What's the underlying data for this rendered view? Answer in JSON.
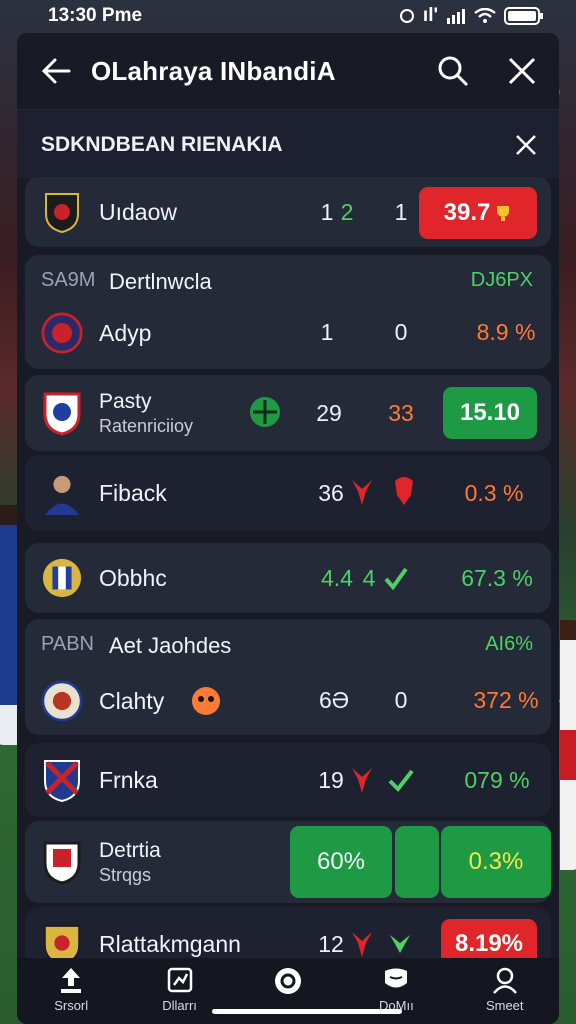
{
  "status_bar": {
    "time": "13:30",
    "carrier": "Pme",
    "signal_text": "ıl'"
  },
  "header": {
    "title": "OLahraya INbandiA",
    "section_title": "SDKNDBEAN RIENAKIA"
  },
  "rows": [
    {
      "team": "Uıdaow",
      "score_a": "1",
      "score_b": "2",
      "score_c": "1",
      "pct": "39.7",
      "pct_style": "red-pill"
    },
    {
      "section": "SA9M",
      "section_name": "Dertlnwcla",
      "section_tag": "DJ6PX"
    },
    {
      "team": "Adyp",
      "score_a": "1",
      "score_b": "0",
      "pct": "8.9 %"
    },
    {
      "team": "Pasty",
      "team_sub": "Ratenriciioy",
      "score_a": "29",
      "score_b": "33",
      "pct": "15.10",
      "pct_style": "green-pill"
    },
    {
      "team": "Fiback",
      "score_a": "36",
      "pct": "0.3 %"
    },
    {
      "team": "Obbhc",
      "score_a": "4.4",
      "score_b": "4",
      "pct": "67.3 %"
    },
    {
      "section": "PABN",
      "section_name": "Aet Jaohdes",
      "section_tag": "AI6%"
    },
    {
      "team": "Clahty",
      "score_a": "6Ə",
      "score_b": "0",
      "pct": "372 %"
    },
    {
      "team": "Frnka",
      "score_a": "19",
      "pct": "079 %"
    },
    {
      "team": "Detrtia",
      "team_sub": "Strqgs",
      "pct_left": "60%",
      "pct": "0.3%"
    },
    {
      "team": "Rlattakmgann",
      "score_a": "12",
      "pct": "8.19%"
    }
  ],
  "tabs": [
    {
      "label": "Srsorl",
      "icon": "upload-icon"
    },
    {
      "label": "Dllarrı",
      "icon": "chart-icon"
    },
    {
      "label": "",
      "icon": "ball-icon"
    },
    {
      "label": "DoMıı",
      "icon": "message-icon"
    },
    {
      "label": "Smeet",
      "icon": "profile-icon"
    }
  ],
  "colors": {
    "panel": "#181b26",
    "row": "#252a39",
    "red": "#e0262b",
    "green": "#1e9a44",
    "orange": "#ff7a36",
    "lightgreen": "#4fd067"
  }
}
